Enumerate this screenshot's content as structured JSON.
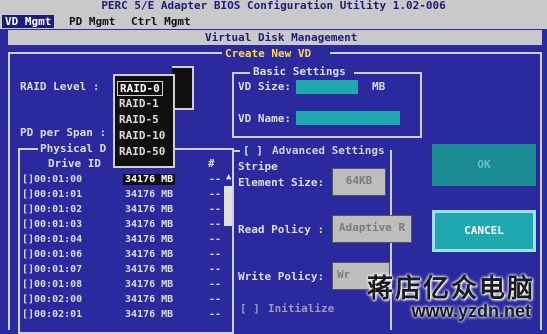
{
  "app": {
    "title": "PERC 5/E Adapter BIOS Configuration Utility 1.02-006"
  },
  "menu": [
    {
      "label": "VD Mgmt",
      "active": true
    },
    {
      "label": "PD Mgmt",
      "active": false
    },
    {
      "label": "Ctrl Mgmt",
      "active": false
    }
  ],
  "panel": {
    "title": "Virtual Disk Management",
    "subtitle": "Create New VD"
  },
  "raid": {
    "label": "RAID Level :",
    "options": [
      "RAID-0",
      "RAID-1",
      "RAID-5",
      "RAID-10",
      "RAID-50"
    ],
    "selected_index": 0
  },
  "pd_per_span": {
    "label": "PD per Span :"
  },
  "physical": {
    "title": "Physical D",
    "col_drive": "Drive ID",
    "col_hash": "#",
    "rows": [
      {
        "check": "[",
        "drive": "]00:01:00",
        "size": "34176 MB",
        "dash": "--"
      },
      {
        "check": "[",
        "drive": "]00:01:01",
        "size": "34176 MB",
        "dash": "--"
      },
      {
        "check": "[",
        "drive": "]00:01:02",
        "size": "34176 MB",
        "dash": "--"
      },
      {
        "check": "[",
        "drive": "]00:01:03",
        "size": "34176 MB",
        "dash": "--"
      },
      {
        "check": "[",
        "drive": "]00:01:04",
        "size": "34176 MB",
        "dash": "--"
      },
      {
        "check": "[",
        "drive": "]00:01:06",
        "size": "34176 MB",
        "dash": "--"
      },
      {
        "check": "[",
        "drive": "]00:01:07",
        "size": "34176 MB",
        "dash": "--"
      },
      {
        "check": "[",
        "drive": "]00:01:08",
        "size": "34176 MB",
        "dash": "--"
      },
      {
        "check": "[",
        "drive": "]00:02:00",
        "size": "34176 MB",
        "dash": "--"
      },
      {
        "check": "[",
        "drive": "]00:02:01",
        "size": "34176 MB",
        "dash": "--"
      }
    ]
  },
  "basic": {
    "title": "Basic Settings",
    "vd_size_label": "VD Size:",
    "unit": "MB",
    "vd_name_label": "VD Name:"
  },
  "advanced": {
    "checkbox": "[ ]",
    "title": "Advanced Settings",
    "stripe_label1": "Stripe",
    "stripe_label2": "Element Size:",
    "stripe_value": "64KB",
    "read_label": "Read Policy :",
    "read_value": "Adaptive R",
    "write_label": "Write Policy:",
    "write_value": "Wr",
    "init_checkbox": "[ ]",
    "init_label": "Initialize"
  },
  "buttons": {
    "ok": "OK",
    "cancel": "CANCEL"
  },
  "watermark": {
    "chinese": "蒋店亿众电脑",
    "url": "www.yzdn.net"
  },
  "colors": {
    "background": "#2a2a9e",
    "accent": "#1fa8b0",
    "highlight": "#ffd84a"
  }
}
